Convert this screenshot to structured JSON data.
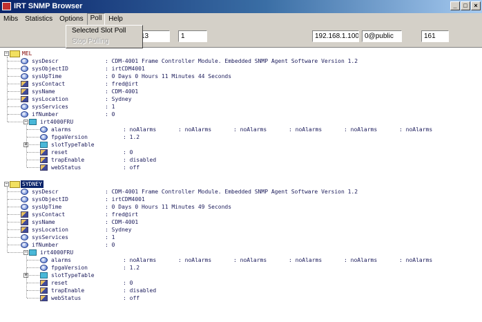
{
  "window": {
    "title": "IRT SNMP Browser",
    "controls": [
      "_",
      "□",
      "×"
    ]
  },
  "menu": [
    "Mibs",
    "Statistics",
    "Options",
    "Poll",
    "Help"
  ],
  "poll_menu": {
    "items": [
      "Selected Slot Poll",
      "Stop Polling"
    ],
    "disabled": [
      false,
      true
    ]
  },
  "toolbar": {
    "field1": "13",
    "field2": "1",
    "ip": "192.168.1.100",
    "community": "0@public",
    "port": "161"
  },
  "attr_names": [
    "sysDescr",
    "sysObjectID",
    "sysUpTime",
    "sysContact",
    "sysName",
    "sysLocation",
    "sysServices",
    "ifNumber"
  ],
  "attr_icons": [
    "leaf",
    "leaf",
    "leaf",
    "rw",
    "rw",
    "rw",
    "leaf",
    "leaf"
  ],
  "fru_children": [
    "alarms",
    "fpgaVersion",
    "slotTypeTable",
    "reset",
    "trapEnable",
    "webStatus"
  ],
  "fru_icons": [
    "leaf",
    "leaf",
    "table",
    "rw",
    "rw",
    "rw"
  ],
  "devices": [
    {
      "label": "MEL",
      "selected": false,
      "values": [
        ": CDM-4001 Frame Controller Module. Embedded SNMP Agent Software Version 1.2",
        ": irtCDM4001",
        ": 0 Days 0 Hours 11 Minutes 44 Seconds",
        ": fred@irt",
        ": CDM-4001",
        ": Sydney",
        ": 1",
        ": 0"
      ],
      "fru": {
        "label": "irt4000FRU",
        "alarms": [
          ": noAlarms",
          ": noAlarms",
          ": noAlarms",
          ": noAlarms",
          ": noAlarms",
          ": noAlarms"
        ],
        "fpgaVersion": ": 1.2",
        "reset": ": 0",
        "trapEnable": ": disabled",
        "webStatus": ": off"
      }
    },
    {
      "label": "SYDNEY",
      "selected": true,
      "values": [
        ": CDM-4001 Frame Controller Module. Embedded SNMP Agent Software Version 1.2",
        ": irtCDM4001",
        ": 0 Days 0 Hours 11 Minutes 49 Seconds",
        ": fred@irt",
        ": CDM-4001",
        ": Sydney",
        ": 1",
        ": 0"
      ],
      "fru": {
        "label": "irt4000FRU",
        "alarms": [
          ": noAlarms",
          ": noAlarms",
          ": noAlarms",
          ": noAlarms",
          ": noAlarms",
          ": noAlarms"
        ],
        "fpgaVersion": ": 1.2",
        "reset": ": 0",
        "trapEnable": ": disabled",
        "webStatus": ": off"
      }
    }
  ]
}
